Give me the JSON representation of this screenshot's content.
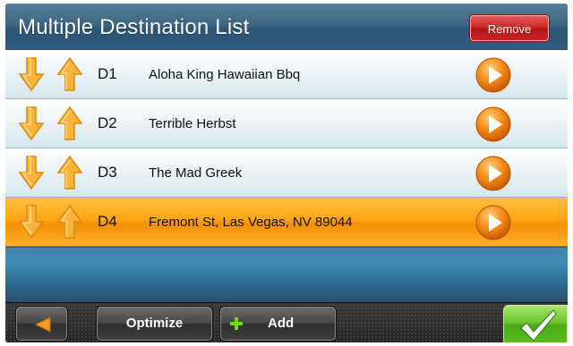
{
  "header": {
    "title": "Multiple Destination List",
    "remove_label": "Remove"
  },
  "destinations": [
    {
      "id": "D1",
      "name": "Aloha King Hawaiian Bbq",
      "selected": false
    },
    {
      "id": "D2",
      "name": "Terrible Herbst",
      "selected": false
    },
    {
      "id": "D3",
      "name": "The Mad Greek",
      "selected": false
    },
    {
      "id": "D4",
      "name": "Fremont St, Las Vegas, NV 89044",
      "selected": true
    }
  ],
  "footer": {
    "back_icon": "left-arrow-icon",
    "optimize_label": "Optimize",
    "add_label": "Add",
    "add_icon": "plus-icon",
    "confirm_icon": "checkmark-icon"
  },
  "colors": {
    "header": "#3d6683",
    "remove": "#c92525",
    "row_selected": "#ffa514",
    "arrow": "#f6a623",
    "go_button": "#f07a12",
    "confirm": "#5bbc22"
  }
}
